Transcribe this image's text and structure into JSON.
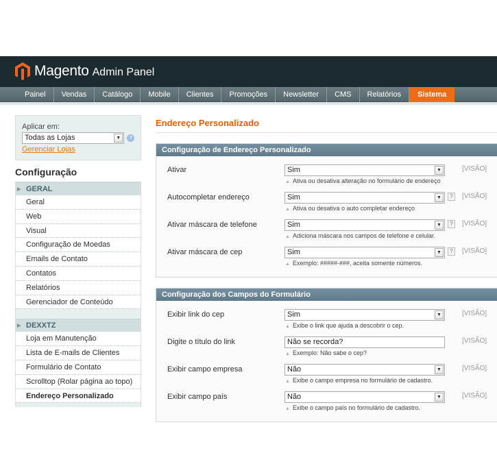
{
  "header": {
    "brand": "Magento",
    "brand_sub": "Admin Panel"
  },
  "nav": {
    "items": [
      "Painel",
      "Vendas",
      "Catálogo",
      "Mobile",
      "Clientes",
      "Promoções",
      "Newsletter",
      "CMS",
      "Relatórios",
      "Sistema"
    ],
    "active": "Sistema"
  },
  "sidebar": {
    "store_label": "Aplicar em:",
    "store_value": "Todas as Lojas",
    "store_link": "Gerenciar Lojas",
    "config_title": "Configuração",
    "groups": [
      {
        "title": "GERAL",
        "items": [
          "Geral",
          "Web",
          "Visual",
          "Configuração de Moedas",
          "Emails de Contato",
          "Contatos",
          "Relatórios",
          "Gerenciador de Conteúdo"
        ]
      },
      {
        "title": "DEXXTZ",
        "items": [
          "Loja em Manutenção",
          "Lista de E-mails de Clientes",
          "Formulário de Contato",
          "Scrolltop (Rolar página ao topo)",
          "Endereço Personalizado"
        ]
      }
    ],
    "selected_item": "Endereço Personalizado"
  },
  "main": {
    "title": "Endereço Personalizado",
    "sections": [
      {
        "title": "Configuração de Endereço Personalizado",
        "rows": [
          {
            "label": "Ativar",
            "value": "Sim",
            "note": "Ativa ou desativa alteração no formulário de endereço",
            "scope": "[VISÃO]",
            "help": false
          },
          {
            "label": "Autocompletar endereço",
            "value": "Sim",
            "note": "Ativa ou desativa o auto completar endereço",
            "scope": "[VISÃO]",
            "help": true
          },
          {
            "label": "Ativar máscara de telefone",
            "value": "Sim",
            "note": "Adiciona máscara nos campos de telefone e celular.",
            "scope": "[VISÃO]",
            "help": true
          },
          {
            "label": "Ativar máscara de cep",
            "value": "Sim",
            "note": "Exemplo: #####-###, aceita somente números.",
            "scope": "[VISÃO]",
            "help": true
          }
        ]
      },
      {
        "title": "Configuração dos Campos do Formulário",
        "rows": [
          {
            "label": "Exibir link do cep",
            "value": "Sim",
            "note": "Exibe o link que ajuda a descobrir o cep.",
            "scope": "[VISÃO]",
            "help": false
          },
          {
            "label": "Digite o título do link",
            "value": "Não se recorda?",
            "note": "Exemplo: Não sabe o cep?",
            "scope": "[VISÃO]",
            "help": false
          },
          {
            "label": "Exibir campo empresa",
            "value": "Não",
            "note": "Exibe o campo empresa no formulário de cadastro.",
            "scope": "[VISÃO]",
            "help": false
          },
          {
            "label": "Exibir campo país",
            "value": "Não",
            "note": "Exibe o campo país no formulário de cadastro.",
            "scope": "[VISÃO]",
            "help": false
          }
        ]
      }
    ],
    "help_glyph": "?",
    "select_arrow_glyph": "▼",
    "note_arrow_glyph": "▲"
  },
  "colors": {
    "header_bg": "#1c2b30",
    "nav_active": "#ec6d16",
    "title_orange": "#eb5e00",
    "section_head": "#6a8596"
  }
}
